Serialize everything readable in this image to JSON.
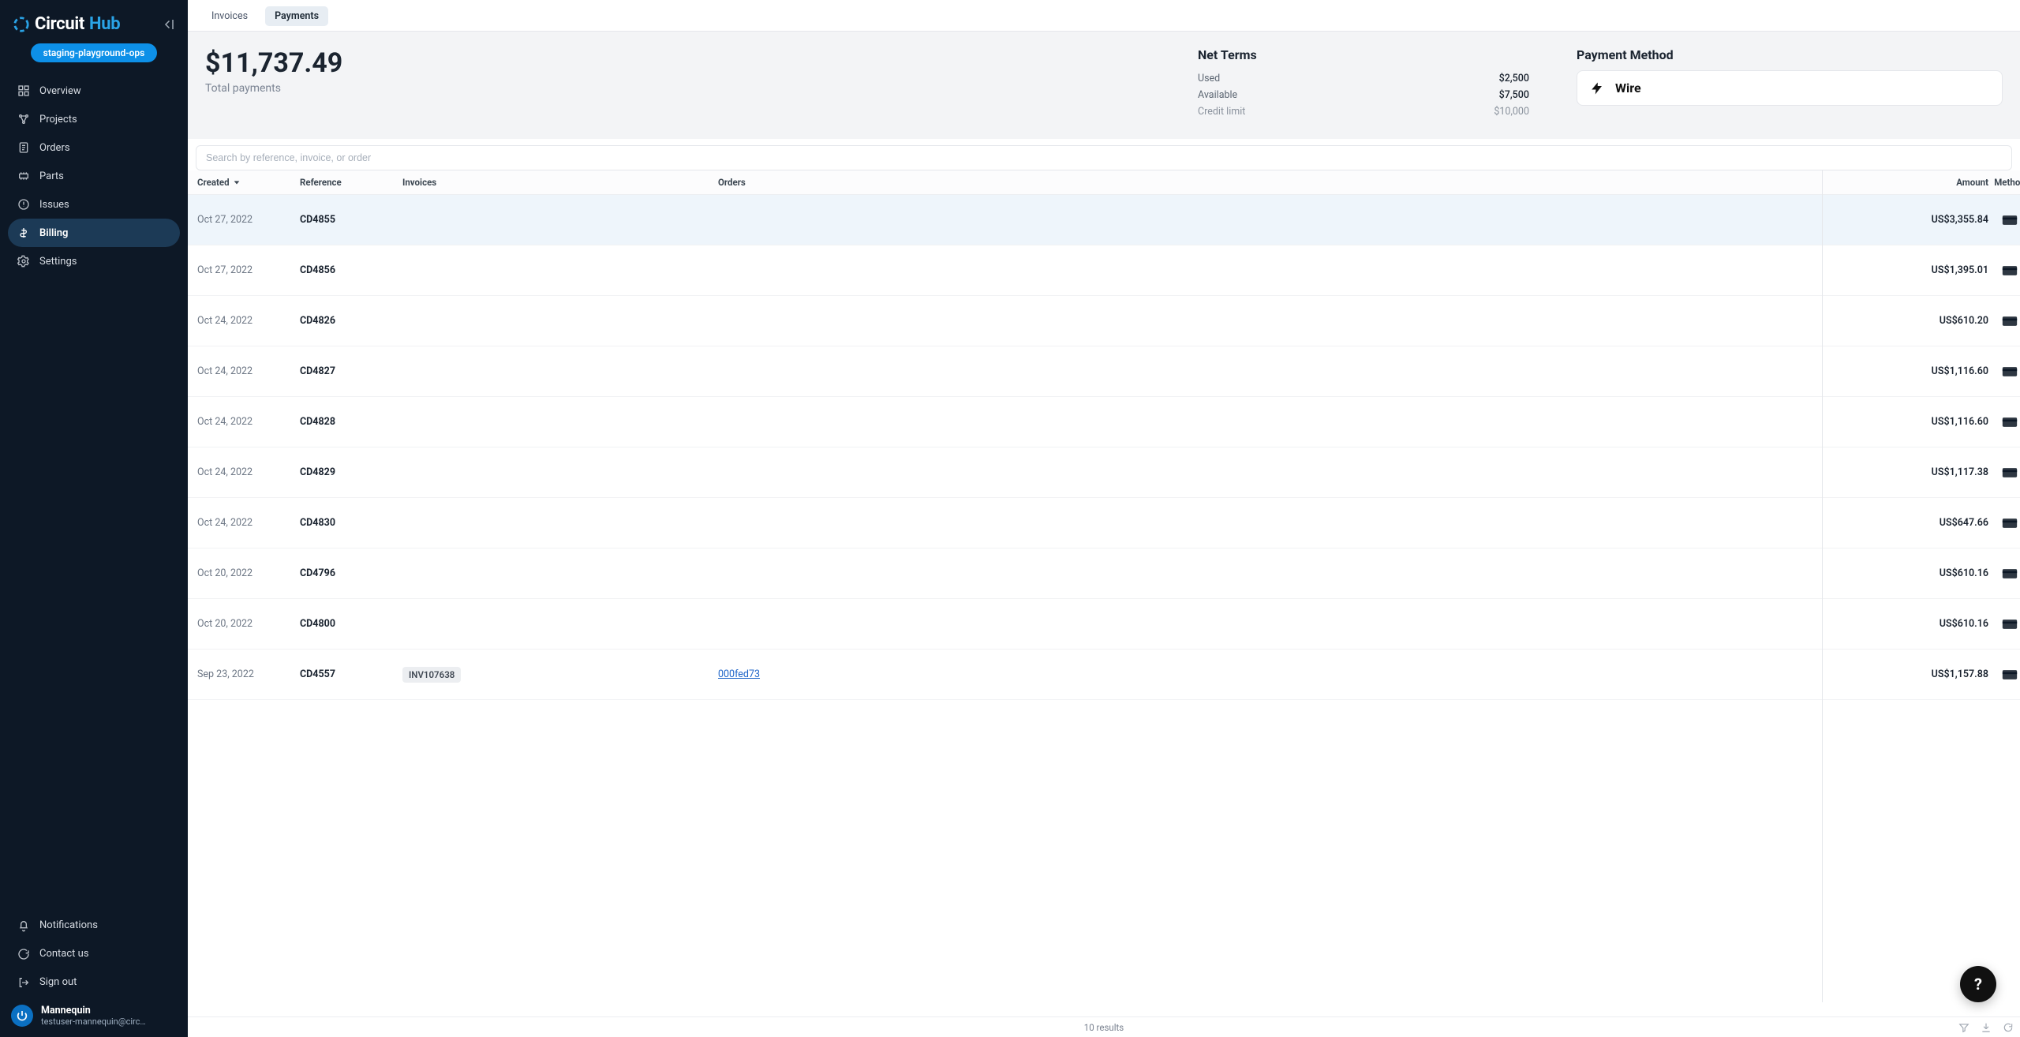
{
  "brand": {
    "name": "Circuit",
    "suffix": "Hub"
  },
  "env_badge": "staging-playground-ops",
  "sidebar": {
    "items": [
      {
        "id": "overview",
        "label": "Overview"
      },
      {
        "id": "projects",
        "label": "Projects"
      },
      {
        "id": "orders",
        "label": "Orders"
      },
      {
        "id": "parts",
        "label": "Parts"
      },
      {
        "id": "issues",
        "label": "Issues"
      },
      {
        "id": "billing",
        "label": "Billing",
        "active": true
      },
      {
        "id": "settings",
        "label": "Settings"
      }
    ],
    "bottom": [
      {
        "id": "notifications",
        "label": "Notifications"
      },
      {
        "id": "contact",
        "label": "Contact us"
      },
      {
        "id": "signout",
        "label": "Sign out"
      }
    ]
  },
  "user": {
    "name": "Mannequin",
    "email": "testuser-mannequin@circ…"
  },
  "tabs": [
    {
      "id": "invoices",
      "label": "Invoices"
    },
    {
      "id": "payments",
      "label": "Payments",
      "active": true
    }
  ],
  "summary": {
    "total": "$11,737.49",
    "total_label": "Total payments",
    "terms_title": "Net Terms",
    "terms": [
      {
        "label": "Used",
        "value": "$2,500"
      },
      {
        "label": "Available",
        "value": "$7,500"
      },
      {
        "label": "Credit limit",
        "value": "$10,000",
        "muted": true
      }
    ],
    "method_title": "Payment Method",
    "method_value": "Wire"
  },
  "search": {
    "placeholder": "Search by reference, invoice, or order"
  },
  "columns": {
    "created": "Created",
    "reference": "Reference",
    "invoices": "Invoices",
    "orders": "Orders",
    "amount": "Amount",
    "method": "Method"
  },
  "rows": [
    {
      "created": "Oct 27, 2022",
      "reference": "CD4855",
      "invoices": [],
      "orders": [],
      "amount": "US$3,355.84",
      "highlight": true
    },
    {
      "created": "Oct 27, 2022",
      "reference": "CD4856",
      "invoices": [],
      "orders": [],
      "amount": "US$1,395.01"
    },
    {
      "created": "Oct 24, 2022",
      "reference": "CD4826",
      "invoices": [],
      "orders": [],
      "amount": "US$610.20"
    },
    {
      "created": "Oct 24, 2022",
      "reference": "CD4827",
      "invoices": [],
      "orders": [],
      "amount": "US$1,116.60"
    },
    {
      "created": "Oct 24, 2022",
      "reference": "CD4828",
      "invoices": [],
      "orders": [],
      "amount": "US$1,116.60"
    },
    {
      "created": "Oct 24, 2022",
      "reference": "CD4829",
      "invoices": [],
      "orders": [],
      "amount": "US$1,117.38"
    },
    {
      "created": "Oct 24, 2022",
      "reference": "CD4830",
      "invoices": [],
      "orders": [],
      "amount": "US$647.66"
    },
    {
      "created": "Oct 20, 2022",
      "reference": "CD4796",
      "invoices": [],
      "orders": [],
      "amount": "US$610.16"
    },
    {
      "created": "Oct 20, 2022",
      "reference": "CD4800",
      "invoices": [],
      "orders": [],
      "amount": "US$610.16"
    },
    {
      "created": "Sep 23, 2022",
      "reference": "CD4557",
      "invoices": [
        "INV107638"
      ],
      "orders": [
        "000fed73"
      ],
      "amount": "US$1,157.88"
    }
  ],
  "footer": {
    "results": "10 results"
  }
}
